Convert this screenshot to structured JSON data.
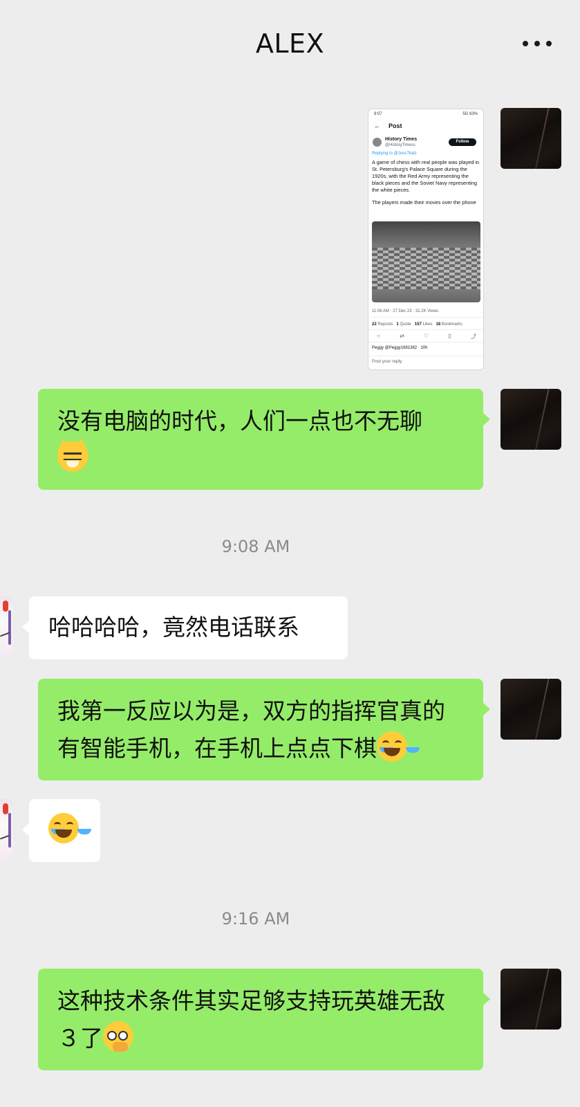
{
  "header": {
    "title": "ALEX",
    "more_icon": "more-horizontal-icon"
  },
  "colors": {
    "background": "#ededed",
    "self_bubble": "#95ec69",
    "other_bubble": "#ffffff",
    "timestamp": "#8a8a8a"
  },
  "screenshot": {
    "status_time": "9:07",
    "status_right": "5G 63%",
    "back_icon": "arrow-left-icon",
    "title": "Post",
    "author_name": "History Times",
    "author_handle": "@HistoryTimess",
    "follow_label": "Follow",
    "replying_to": "Replying to @Juoc7katz",
    "text": "A game of chess with real people was played in St. Petersburg's Palace Square during the 1920s, with the Red Army representing the black pieces and the Soviet Navy representing the white pieces.",
    "text2": "The players made their moves over the phone",
    "meta": "11:06 AM · 27 Dec 23 · 32.2K Views",
    "stats": {
      "reposts": "22",
      "reposts_label": "Reposts",
      "quotes": "1",
      "quotes_label": "Quote",
      "likes": "157",
      "likes_label": "Likes",
      "bookmarks": "18",
      "bookmarks_label": "Bookmarks"
    },
    "reply_preview": "Peggy @Peggy1681382 · 10h",
    "post_reply_placeholder": "Post your reply"
  },
  "messages": [
    {
      "side": "self",
      "text": "没有电脑的时代，人们一点也不无聊"
    },
    {
      "time": "9:08 AM"
    },
    {
      "side": "other",
      "text": "哈哈哈哈，竟然电话联系"
    },
    {
      "side": "self",
      "text": "我第一反应以为是，双方的指挥官真的有智能手机，在手机上点点下棋"
    },
    {
      "time": "9:16 AM"
    },
    {
      "side": "self",
      "text": "这种技术条件其实足够支持玩英雄无敌３了"
    }
  ]
}
